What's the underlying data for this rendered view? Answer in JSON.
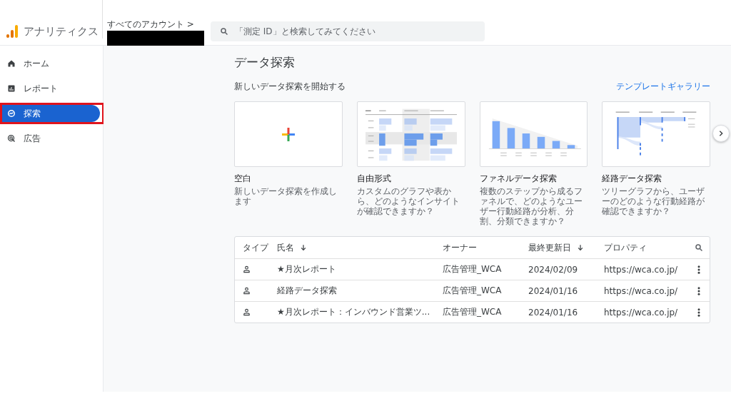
{
  "header": {
    "app_name": "アナリティクス",
    "breadcrumb": "すべてのアカウント >",
    "search": {
      "placeholder": "「測定 ID」と検索してみてください"
    }
  },
  "sidebar": {
    "items": [
      {
        "label": "ホーム",
        "selected": false,
        "highlighted": false
      },
      {
        "label": "レポート",
        "selected": false,
        "highlighted": false
      },
      {
        "label": "探索",
        "selected": true,
        "highlighted": true
      },
      {
        "label": "広告",
        "selected": false,
        "highlighted": false
      }
    ]
  },
  "main": {
    "title": "データ探索",
    "subtitle": "新しいデータ探索を開始する",
    "gallery_link": "テンプレートギャラリー",
    "templates": [
      {
        "kind": "blank",
        "title": "空白",
        "description": "新しいデータ探索を作成します"
      },
      {
        "kind": "freeform",
        "title": "自由形式",
        "description": "カスタムのグラフや表から、どのようなインサイトが確認できますか？"
      },
      {
        "kind": "funnel",
        "title": "ファネルデータ探索",
        "description": "複数のステップから成るファネルで、どのようなユーザー行動経路が分析、分割、分類できますか？"
      },
      {
        "kind": "path",
        "title": "経路データ探索",
        "description": "ツリーグラフから、ユーザーのどのような行動経路が確認できますか？"
      }
    ],
    "table": {
      "columns": [
        {
          "label": "タイプ",
          "sorted": false
        },
        {
          "label": "氏名",
          "sorted": true
        },
        {
          "label": "オーナー",
          "sorted": false
        },
        {
          "label": "最終更新日",
          "sorted": true
        },
        {
          "label": "プロパティ",
          "sorted": false
        }
      ],
      "rows": [
        {
          "name": "★月次レポート",
          "owner": "広告管理_WCA",
          "updated": "2024/02/09",
          "property": "https://wca.co.jp/"
        },
        {
          "name": "経路データ探索",
          "owner": "広告管理_WCA",
          "updated": "2024/01/16",
          "property": "https://wca.co.jp/"
        },
        {
          "name": "★月次レポート：インバウンド営業ツ...",
          "owner": "広告管理_WCA",
          "updated": "2024/01/16",
          "property": "https://wca.co.jp/"
        }
      ]
    }
  }
}
